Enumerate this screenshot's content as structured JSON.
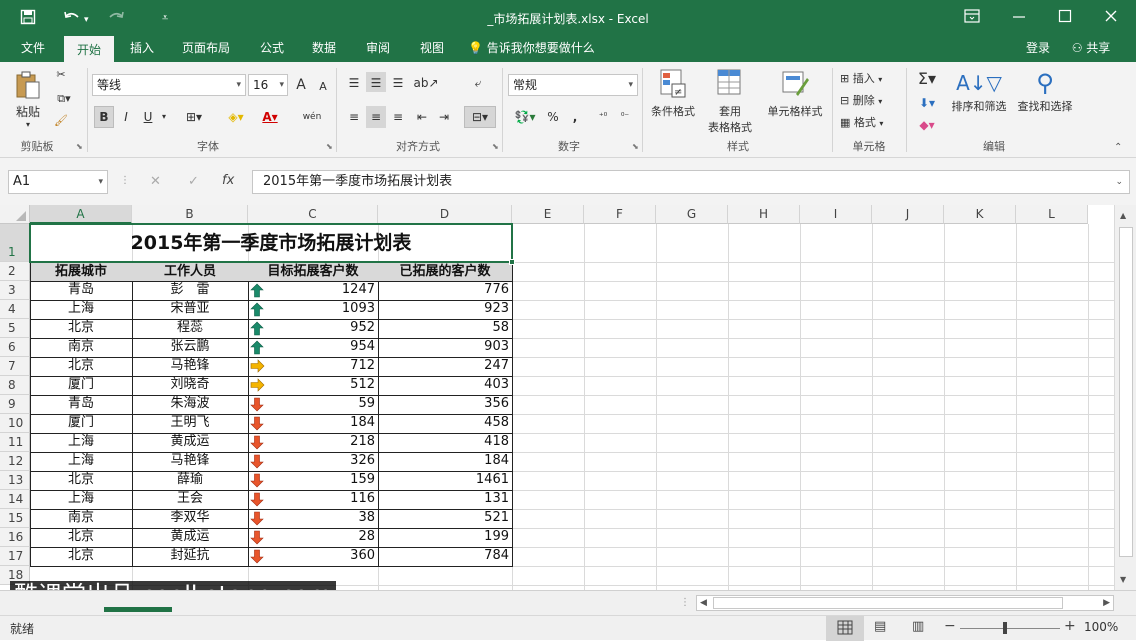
{
  "window": {
    "title": "_市场拓展计划表.xlsx - Excel",
    "quick_access": [
      "save-icon",
      "undo-icon",
      "redo-icon",
      "customize-icon"
    ],
    "controls": [
      "ribbon-display-icon",
      "minimize-icon",
      "maximize-icon",
      "close-icon"
    ]
  },
  "tabs": [
    "文件",
    "开始",
    "插入",
    "页面布局",
    "公式",
    "数据",
    "审阅",
    "视图"
  ],
  "active_tab": "开始",
  "tell_me": "告诉我你想要做什么",
  "login": "登录",
  "share": "共享",
  "ribbon": {
    "clipboard": {
      "label": "剪贴板",
      "paste": "粘贴"
    },
    "font": {
      "label": "字体",
      "font_name": "等线",
      "font_size": "16",
      "grow": "A",
      "shrink": "A",
      "bold": "B",
      "italic": "I",
      "underline": "U",
      "phonetic": "wén"
    },
    "alignment": {
      "label": "对齐方式"
    },
    "number": {
      "label": "数字",
      "format": "常规",
      "percent": "%",
      "comma": ","
    },
    "styles": {
      "label": "样式",
      "cond_format": "条件格式",
      "table_format_1": "套用",
      "table_format_2": "表格格式",
      "cell_styles": "单元格样式"
    },
    "cells": {
      "label": "单元格",
      "insert": "插入",
      "delete": "删除",
      "format": "格式"
    },
    "editing": {
      "label": "编辑",
      "sort_filter": "排序和筛选",
      "find_select": "查找和选择"
    }
  },
  "formula_bar": {
    "name_box": "A1",
    "cancel": "✕",
    "enter": "✓",
    "fx": "fx",
    "content": "2015年第一季度市场拓展计划表"
  },
  "columns": [
    "A",
    "B",
    "C",
    "D",
    "E",
    "F",
    "G",
    "H",
    "I",
    "J",
    "K",
    "L"
  ],
  "row_numbers": [
    "1",
    "2",
    "3",
    "4",
    "5",
    "6",
    "7",
    "8",
    "9",
    "10",
    "11",
    "12",
    "13",
    "14",
    "15",
    "16",
    "17",
    "18"
  ],
  "sheet": {
    "title": "2015年第一季度市场拓展计划表",
    "headers": [
      "拓展城市",
      "工作人员",
      "目标拓展客户数",
      "已拓展的客户数"
    ],
    "rows": [
      {
        "city": "青岛",
        "person": "彭　雷",
        "target": "1247",
        "done": "776",
        "trend": "up"
      },
      {
        "city": "上海",
        "person": "宋普亚",
        "target": "1093",
        "done": "923",
        "trend": "up"
      },
      {
        "city": "北京",
        "person": "程蕊",
        "target": "952",
        "done": "58",
        "trend": "up"
      },
      {
        "city": "南京",
        "person": "张云鹏",
        "target": "954",
        "done": "903",
        "trend": "up"
      },
      {
        "city": "北京",
        "person": "马艳锋",
        "target": "712",
        "done": "247",
        "trend": "flat"
      },
      {
        "city": "厦门",
        "person": "刘晓奇",
        "target": "512",
        "done": "403",
        "trend": "flat"
      },
      {
        "city": "青岛",
        "person": "朱海波",
        "target": "59",
        "done": "356",
        "trend": "down"
      },
      {
        "city": "厦门",
        "person": "王明飞",
        "target": "184",
        "done": "458",
        "trend": "down"
      },
      {
        "city": "上海",
        "person": "黄成运",
        "target": "218",
        "done": "418",
        "trend": "down"
      },
      {
        "city": "上海",
        "person": "马艳锋",
        "target": "326",
        "done": "184",
        "trend": "down"
      },
      {
        "city": "北京",
        "person": "薛瑜",
        "target": "159",
        "done": "1461",
        "trend": "down"
      },
      {
        "city": "上海",
        "person": "王会",
        "target": "116",
        "done": "131",
        "trend": "down"
      },
      {
        "city": "南京",
        "person": "李双华",
        "target": "38",
        "done": "521",
        "trend": "down"
      },
      {
        "city": "北京",
        "person": "黄成运",
        "target": "28",
        "done": "199",
        "trend": "down"
      },
      {
        "city": "北京",
        "person": "封延抗",
        "target": "360",
        "done": "784",
        "trend": "down"
      }
    ]
  },
  "trend_colors": {
    "up": "#1a8a6a",
    "flat": "#f4b400",
    "down": "#e8552b"
  },
  "watermark": "酷课堂出品 coolketang.com",
  "status": {
    "ready": "就绪",
    "zoom": "100%",
    "minus": "−",
    "plus": "+"
  }
}
